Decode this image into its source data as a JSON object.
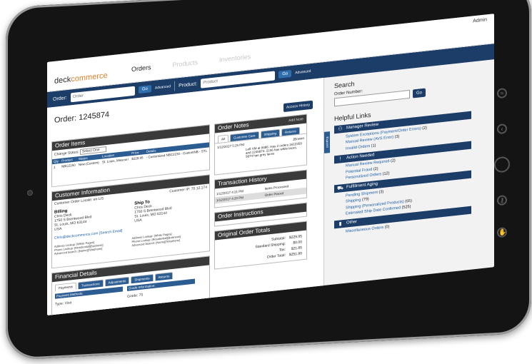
{
  "header": {
    "admin": "Admin",
    "logo_a": "deck",
    "logo_b": "commerce",
    "nav": [
      "Orders",
      "Products",
      "Inventories"
    ]
  },
  "searchbar": {
    "order_label": "Order:",
    "order_placeholder": "Order",
    "go": "Go",
    "advanced": "Advanced",
    "product_label": "Product:",
    "product_placeholder": "Product"
  },
  "order": {
    "title": "Order: 1245874",
    "access_history": "Access History",
    "expand": "Expand"
  },
  "order_items": {
    "title": "Order Items",
    "change_status": "Change Status:",
    "status_value": "Select One",
    "columns": [
      "Qty",
      "Product",
      "Status",
      "Location",
      "Price",
      "Details"
    ],
    "rows": [
      {
        "qty": "1",
        "product": "NBC2150",
        "status": "New (Custom)",
        "location": "St. Louis, Missouri",
        "price": "$229.95",
        "details": "- Customized NBC2150 - CustomNB - STL"
      }
    ]
  },
  "customer": {
    "title": "Customer Information",
    "locale": "Customer Order Locale: en-US",
    "ip": "Customer IP: 70.12.174",
    "billing": {
      "heading": "Billing",
      "lines": [
        "Chris Deck",
        "1750 S Brentwood Blvd",
        "St. Louis, MO 63144",
        "USA"
      ]
    },
    "shipto": {
      "heading": "Ship To",
      "lines": [
        "Chris Deck",
        "1750 S Brentwood Blvd",
        "St. Louis, MO 63144",
        "USA"
      ]
    },
    "email": "Chris@deckcommerce.com [Search Email]",
    "lookup_billing": [
      "Address Lookup: [White Pages]",
      "Phone Lookup: [Residential][Business]",
      "Advanced Search: [Name][Telephone]"
    ],
    "lookup_ship": [
      "Address Lookup: [White Pages]",
      "Phone Lookup: [Residential][Business]",
      "Advanced Search: [Name][Telephone]"
    ]
  },
  "financial": {
    "title": "Financial Details",
    "tabs": [
      "Payments",
      "Transactions",
      "Adjustments",
      "Shipments",
      "Returns"
    ],
    "payment_methods": "Payment Methods:",
    "type": "Type: Visa",
    "grade_info": "Grade Information:",
    "grade": "Grade: 70"
  },
  "notes": {
    "title": "Order Notes",
    "add_note": "Add Note",
    "tabs": [
      "All",
      "Customer Care",
      "Shipping",
      "Returns"
    ],
    "entry_date": "1/12/2017 5:25 PM",
    "entry_user": "JBowen",
    "entry_text": "Left VM at 9486. Has 2 orders 1612359 and 1245874. 2106 has white laces, 5874 has grey laces"
  },
  "history": {
    "title": "Transaction History",
    "rows": [
      [
        "1/12/2017 4:21 PM",
        "Items Processed"
      ],
      [
        "1/12/2017 4:20 PM",
        "Order Placed"
      ]
    ]
  },
  "instructions": {
    "title": "Order Instructions"
  },
  "totals": {
    "title": "Original Order Totals",
    "rows": [
      [
        "Subtotal:",
        "$229.95"
      ],
      [
        "Standard Shipping:",
        "$0.00"
      ],
      [
        "Tax:",
        "$21.85"
      ],
      [
        "Order Total:",
        "$251.80"
      ]
    ]
  },
  "right": {
    "search_title": "Search",
    "order_number_label": "Order Number:",
    "go": "Go",
    "helpful_links": "Helpful Links",
    "sections": [
      {
        "title": "Manager Review",
        "icon": "binoculars-icon",
        "items": [
          [
            "System Exceptions (Payment/Order Errors)",
            "(2)"
          ],
          [
            "Manual Review (AVS Error)",
            "(3)"
          ],
          [
            "Invalid Orders",
            "(1)"
          ]
        ]
      },
      {
        "title": "Action Needed",
        "icon": "alert-icon",
        "items": [
          [
            "Manual Review Required",
            "(2)"
          ],
          [
            "Potential Fraud",
            "(2)"
          ],
          [
            "Personalized Orders",
            "(12)"
          ]
        ]
      },
      {
        "title": "Fulfillment Aging",
        "icon": "truck-icon",
        "items": [
          [
            "Pending Shipment",
            "(3)"
          ],
          [
            "Shipping",
            "(79)"
          ],
          [
            "Shipping (Personalized Products)",
            "(65)"
          ],
          [
            "Estimated Ship Date Confirmed",
            "(525)"
          ]
        ]
      },
      {
        "title": "Other",
        "icon": "bookmark-icon",
        "items": [
          [
            "Miscellaneous Orders",
            "(0)"
          ]
        ]
      }
    ]
  }
}
